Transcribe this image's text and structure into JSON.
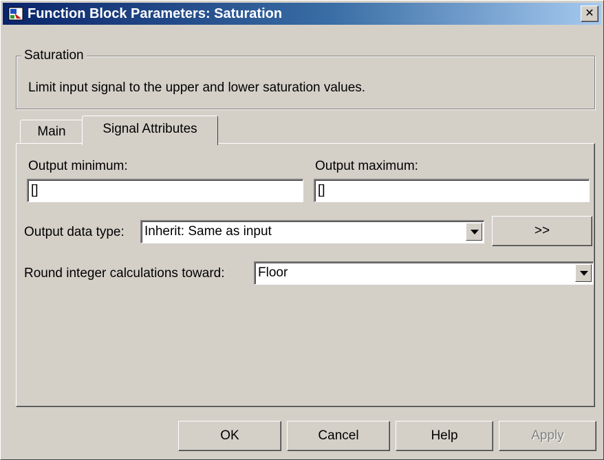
{
  "window": {
    "title": "Function Block Parameters: Saturation"
  },
  "group": {
    "legend": "Saturation",
    "description": "Limit input signal to the upper and lower saturation values."
  },
  "tabs": [
    {
      "label": "Main",
      "selected": false
    },
    {
      "label": "Signal Attributes",
      "selected": true
    }
  ],
  "signal_attributes": {
    "output_min_label": "Output minimum:",
    "output_min_value": "[]",
    "output_max_label": "Output maximum:",
    "output_max_value": "[]",
    "data_type_label": "Output data type:",
    "data_type_value": "Inherit: Same as input",
    "data_type_assistant": ">>",
    "round_label": "Round integer calculations toward:",
    "round_value": "Floor"
  },
  "buttons": {
    "ok": "OK",
    "cancel": "Cancel",
    "help": "Help",
    "apply": "Apply"
  },
  "icons": {
    "close": "close-icon",
    "app": "simulink-block-icon"
  }
}
